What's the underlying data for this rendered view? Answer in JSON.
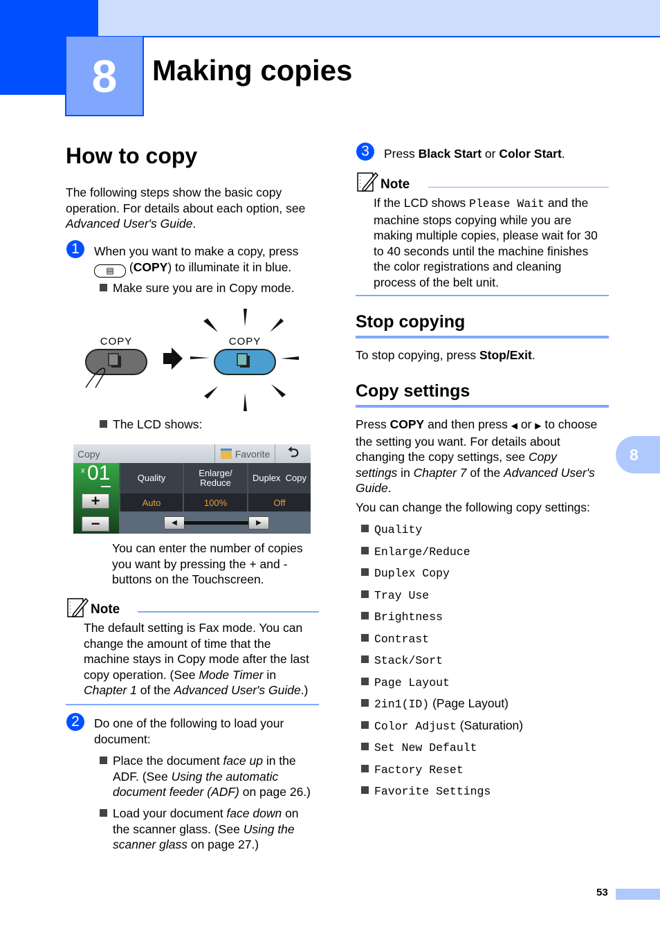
{
  "chapter": {
    "number": "8",
    "title": "Making copies"
  },
  "left": {
    "heading": "How to copy",
    "intro": {
      "line1": "The following steps show the basic copy",
      "line2": "operation. For details about each option, see",
      "line3_italic": "Advanced User's Guide",
      "line3_end": "."
    },
    "step1": {
      "num": "1",
      "line1": "When you want to make a copy, press",
      "paren_open": "(",
      "bold": "COPY",
      "line2_rest": ") to illuminate it in blue.",
      "bullet": "Make sure you are in Copy mode."
    },
    "illustration": {
      "left_label": "COPY",
      "right_label": "COPY"
    },
    "lcd_bullet": "The LCD shows:",
    "lcd": {
      "title": "Copy",
      "favorite": "Favorite",
      "back_icon": "⮌",
      "count_prefix": "x",
      "count": "01",
      "plus": "+",
      "minus": "−",
      "cells": [
        {
          "label": "Quality",
          "value": "Auto"
        },
        {
          "label": "Enlarge/ Reduce",
          "value": "100%"
        },
        {
          "label": "Duplex  Copy",
          "value": "Off"
        }
      ],
      "left_arrow": "◀",
      "right_arrow": "▶"
    },
    "copies_text": {
      "line1": "You can enter the number of copies",
      "line2": "you want by pressing the + and -",
      "line3": "buttons on the Touchscreen."
    },
    "note": {
      "title": "Note",
      "line1": "The default setting is Fax mode. You can",
      "line2": "change the amount of time that the",
      "line3": "machine stays in Copy mode after the last",
      "line4_a": "copy operation. (See ",
      "line4_i": "Mode Timer",
      "line4_b": " in",
      "line5_i1": "Chapter 1",
      "line5_a": " of the ",
      "line5_i2": "Advanced User's Guide",
      "line5_b": ".)"
    },
    "step2": {
      "num": "2",
      "line1": "Do one of the following to load your",
      "line2": "document:",
      "b1": {
        "a": "Place the document ",
        "i": "face up",
        "b": " in the",
        "l2a": "ADF. (See ",
        "l2i": "Using the automatic",
        "l3i": "document feeder (ADF)",
        "l3b": " on page 26.)"
      },
      "b2": {
        "a": "Load your document ",
        "i": "face down",
        "b": " on",
        "l2a": "the scanner glass. (See ",
        "l2i": "Using the",
        "l3i": "scanner glass",
        "l3b": " on page 27.)"
      }
    }
  },
  "right": {
    "step3": {
      "num": "3",
      "a": "Press ",
      "b1": "Black Start",
      "mid": " or ",
      "b2": "Color Start",
      "end": "."
    },
    "note": {
      "title": "Note",
      "l1a": "If the LCD shows ",
      "l1mono": "Please Wait",
      "l1b": " and the",
      "l2": "machine stops copying while you are",
      "l3": "making multiple copies, please wait for 30",
      "l4": "to 40 seconds until the machine finishes",
      "l5": "the color registrations and cleaning",
      "l6": "process of the belt unit."
    },
    "stop": {
      "heading": "Stop copying",
      "a": "To stop copying, press ",
      "b": "Stop/Exit",
      "end": "."
    },
    "settings": {
      "heading": "Copy settings",
      "p1": {
        "a": "Press ",
        "b": "COPY",
        "c": " and then press ",
        "la": "◀",
        "or": " or ",
        "ra": "▶",
        "d": " to choose",
        "l2": "the setting you want. For details about",
        "l3a": "changing the copy settings, see ",
        "l3i": "Copy",
        "l4i": "settings",
        "l4a": " in ",
        "l4i2": "Chapter 7",
        "l4b": " of the ",
        "l4i3": "Advanced User's",
        "l5i": "Guide",
        "l5b": "."
      },
      "p2": "You can change the following copy settings:",
      "items": [
        {
          "mono": "Quality",
          "extra": ""
        },
        {
          "mono": "Enlarge/Reduce",
          "extra": ""
        },
        {
          "mono": "Duplex Copy",
          "extra": ""
        },
        {
          "mono": "Tray Use",
          "extra": ""
        },
        {
          "mono": "Brightness",
          "extra": ""
        },
        {
          "mono": "Contrast",
          "extra": ""
        },
        {
          "mono": "Stack/Sort",
          "extra": ""
        },
        {
          "mono": "Page Layout",
          "extra": ""
        },
        {
          "mono": "2in1(ID)",
          "extra": " (Page Layout)"
        },
        {
          "mono": "Color Adjust",
          "extra": " (Saturation)"
        },
        {
          "mono": "Set New Default",
          "extra": ""
        },
        {
          "mono": "Factory Reset",
          "extra": ""
        },
        {
          "mono": "Favorite Settings",
          "extra": ""
        }
      ]
    }
  },
  "side_tab": "8",
  "page_number": "53"
}
